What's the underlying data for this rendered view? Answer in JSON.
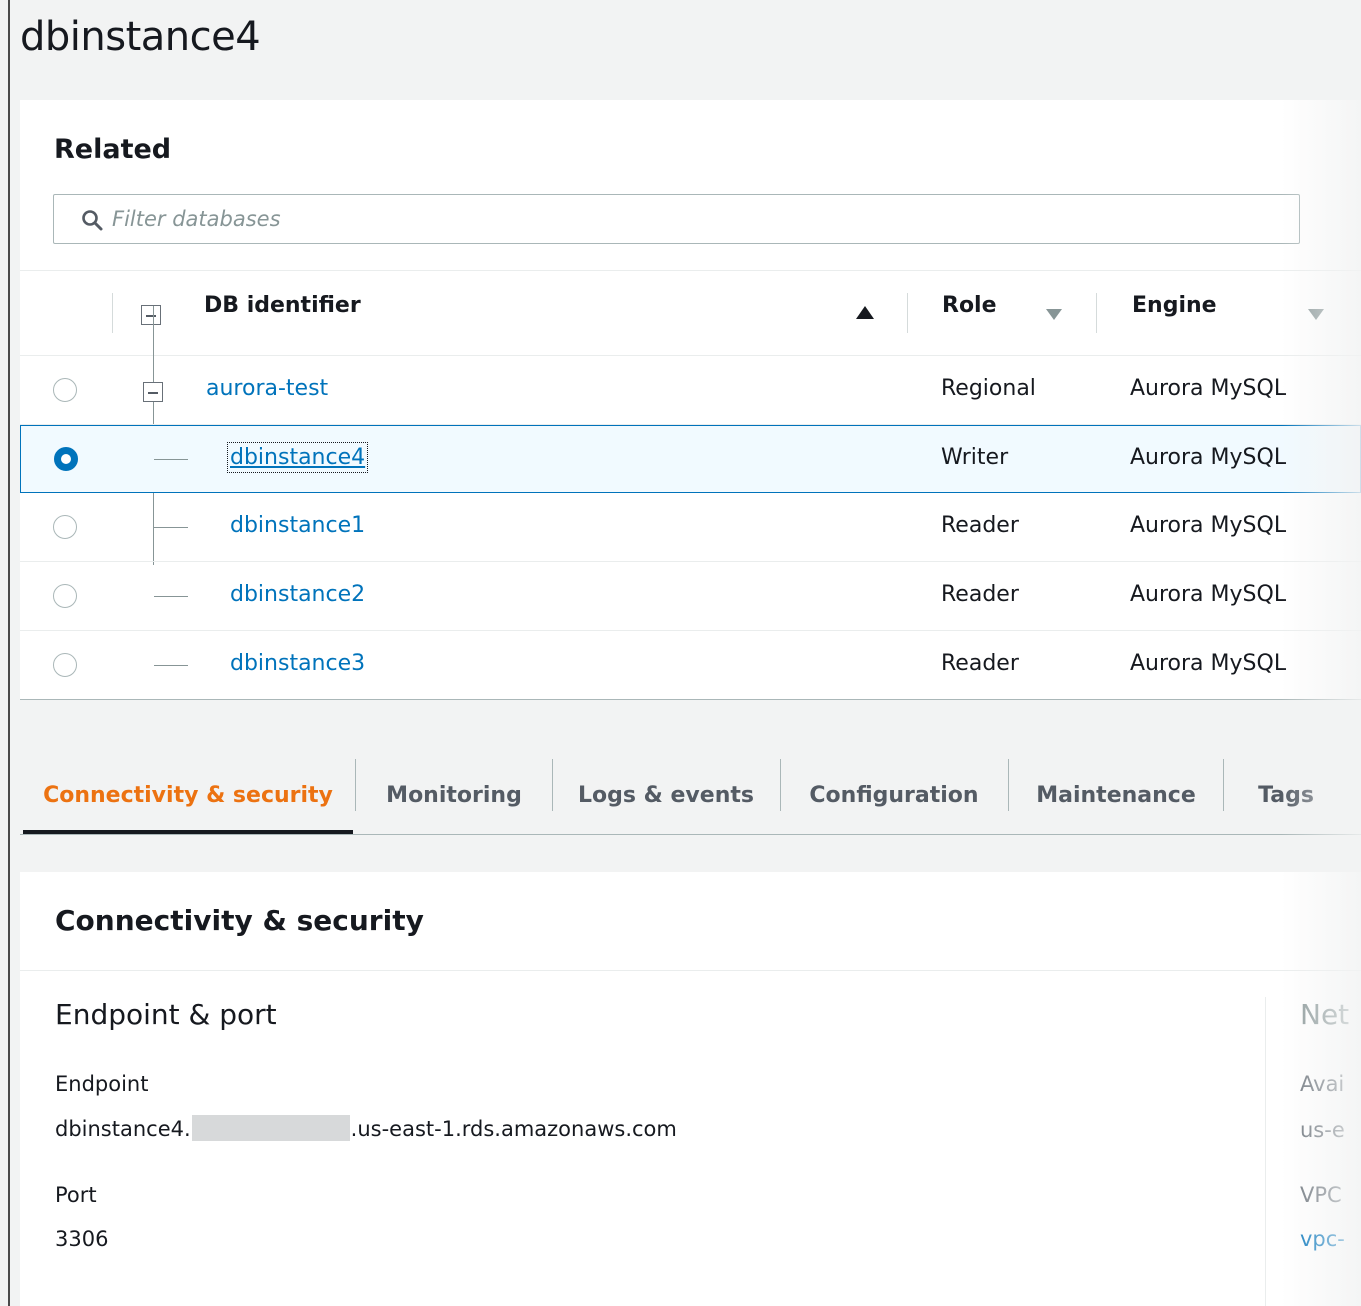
{
  "page": {
    "title": "dbinstance4"
  },
  "related": {
    "title": "Related",
    "filter_placeholder": "Filter databases",
    "columns": {
      "db_identifier": "DB identifier",
      "role": "Role",
      "engine": "Engine"
    },
    "rows": [
      {
        "id": "aurora-test",
        "role": "Regional",
        "engine": "Aurora MySQL",
        "selected": false,
        "level": 0
      },
      {
        "id": "dbinstance4",
        "role": "Writer",
        "engine": "Aurora MySQL",
        "selected": true,
        "level": 1
      },
      {
        "id": "dbinstance1",
        "role": "Reader",
        "engine": "Aurora MySQL",
        "selected": false,
        "level": 1
      },
      {
        "id": "dbinstance2",
        "role": "Reader",
        "engine": "Aurora MySQL",
        "selected": false,
        "level": 1
      },
      {
        "id": "dbinstance3",
        "role": "Reader",
        "engine": "Aurora MySQL",
        "selected": false,
        "level": 1
      }
    ]
  },
  "tabs": [
    {
      "label": "Connectivity & security",
      "active": true
    },
    {
      "label": "Monitoring",
      "active": false
    },
    {
      "label": "Logs & events",
      "active": false
    },
    {
      "label": "Configuration",
      "active": false
    },
    {
      "label": "Maintenance",
      "active": false
    },
    {
      "label": "Tags",
      "active": false
    }
  ],
  "connectivity": {
    "title": "Connectivity & security",
    "endpoint_section": {
      "heading": "Endpoint & port",
      "endpoint_label": "Endpoint",
      "endpoint_prefix": "dbinstance4.",
      "endpoint_suffix": ".us-east-1.rds.amazonaws.com",
      "port_label": "Port",
      "port_value": "3306"
    },
    "network_section_partial": {
      "heading": "Net",
      "az_label": "Avai",
      "az_value": "us-e",
      "vpc_label": "VPC",
      "vpc_value": "vpc-"
    }
  },
  "colors": {
    "link": "#0073bb",
    "active_tab": "#ec7211",
    "selected_row_bg": "#f1faff"
  }
}
